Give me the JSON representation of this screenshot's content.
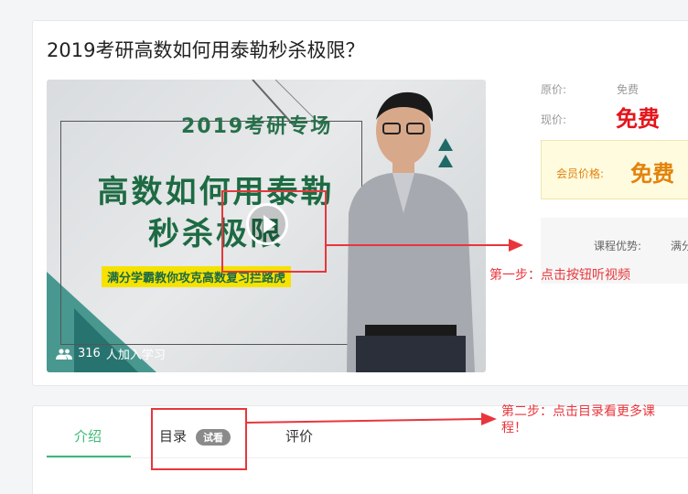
{
  "course": {
    "title": "2019考研高数如何用泰勒秒杀极限？",
    "learners_count": "316",
    "learners_suffix": "人加入学习"
  },
  "poster": {
    "tag": "2019考研专场",
    "headline_line1": "高数如何用泰勒",
    "headline_line2": "秒杀极限",
    "subtitle": "满分学霸教你攻克高数复习拦路虎"
  },
  "pricing": {
    "original_label": "原价:",
    "original_value": "免费",
    "current_label": "现价:",
    "current_value": "免费",
    "member_label": "会员价格:",
    "member_value": "免费",
    "advantage_label": "课程优势:",
    "advantage_value": "满分"
  },
  "tabs": {
    "intro": "介绍",
    "catalog": "目录",
    "catalog_badge": "试看",
    "review": "评价"
  },
  "annotations": {
    "step1": "第一步：点击按钮听视频",
    "step2_line1": "第二步：点击目录看更多课",
    "step2_line2": "程！"
  },
  "colors": {
    "accent_green": "#3cb878",
    "price_red": "#e4151b",
    "member_orange": "#e2830c",
    "annotation_red": "#e8363c"
  }
}
